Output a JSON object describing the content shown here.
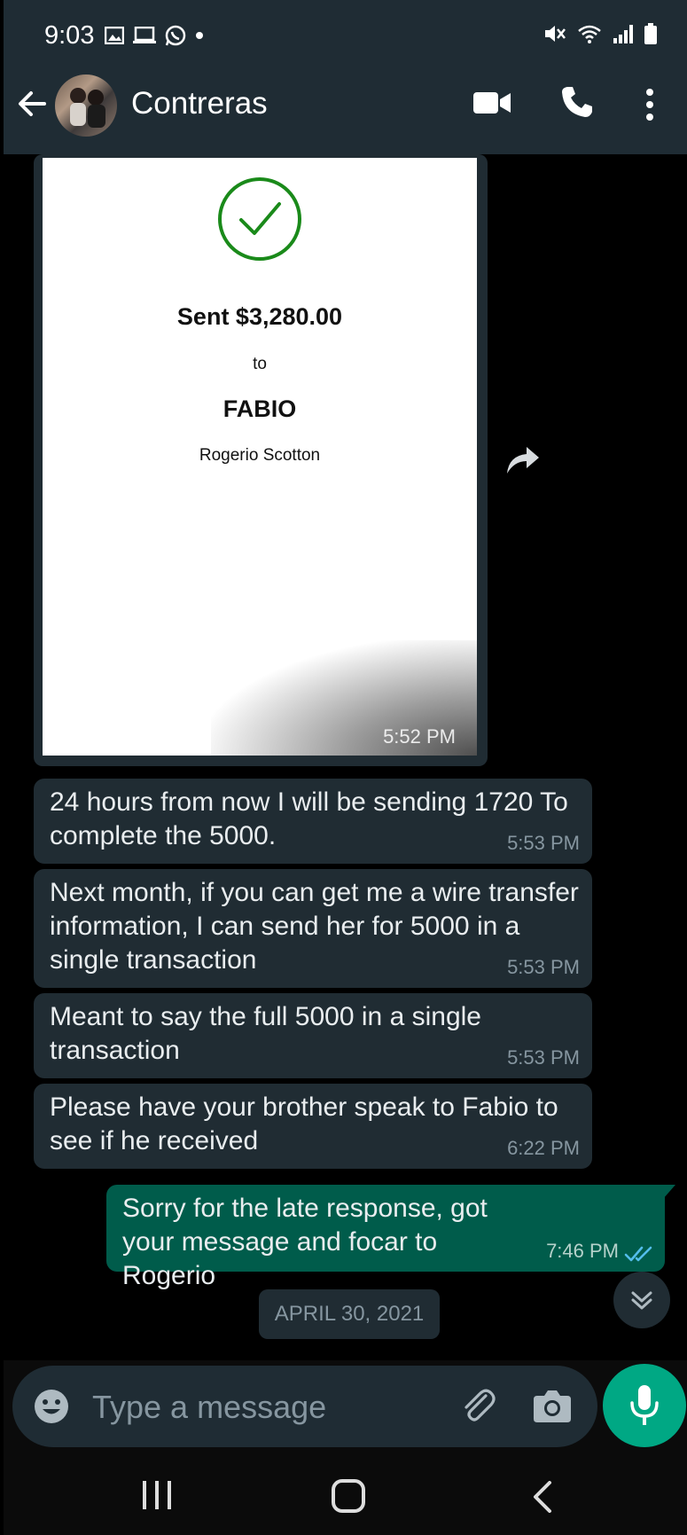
{
  "status_bar": {
    "time": "9:03",
    "left_icons": [
      "image-icon",
      "laptop-icon",
      "whatsapp-icon",
      "dot-icon"
    ],
    "right_icons": [
      "mute-icon",
      "wifi-icon",
      "signal-icon",
      "battery-icon"
    ]
  },
  "header": {
    "contact_name": "Contreras",
    "icons": [
      "back-arrow-icon",
      "video-call-icon",
      "phone-icon",
      "more-options-icon"
    ]
  },
  "messages": [
    {
      "type": "image",
      "direction": "incoming",
      "receipt": {
        "title": "Sent $3,280.00",
        "to": "to",
        "recipient": "FABIO",
        "sender": "Rogerio Scotton"
      },
      "time": "5:52 PM"
    },
    {
      "type": "text",
      "direction": "incoming",
      "text": "24 hours from now I will be sending 1720 To complete the 5000.",
      "time": "5:53 PM"
    },
    {
      "type": "text",
      "direction": "incoming",
      "text": "Next month, if you can get me a wire transfer information, I can send her for 5000 in a single transaction",
      "time": "5:53 PM"
    },
    {
      "type": "text",
      "direction": "incoming",
      "text": "Meant to say the full 5000 in a single transaction",
      "time": "5:53 PM"
    },
    {
      "type": "text",
      "direction": "incoming",
      "text": "Please have your brother speak to Fabio to see if he received",
      "time": "6:22 PM"
    },
    {
      "type": "text",
      "direction": "outgoing",
      "text": "Sorry for the late response, got your message and focar to Rogerio",
      "time": "7:46 PM",
      "status": "read"
    }
  ],
  "date_divider": "APRIL 30, 2021",
  "composer": {
    "placeholder": "Type a message"
  },
  "colors": {
    "header_bg": "#1f2c34",
    "incoming_bubble": "#202c33",
    "outgoing_bubble": "#005c4b",
    "accent": "#00a884",
    "read_ticks": "#53bdeb",
    "receipt_check": "#1a8a1a"
  }
}
